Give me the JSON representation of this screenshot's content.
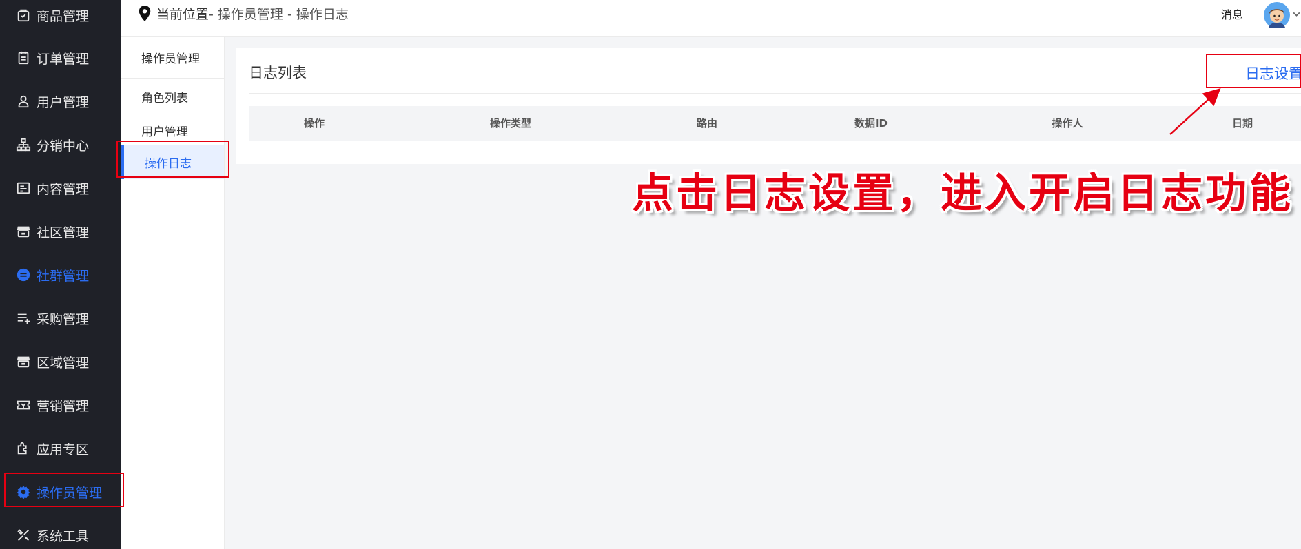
{
  "sidebar": {
    "items": [
      {
        "label": "商品管理",
        "icon": "bag-check-icon"
      },
      {
        "label": "订单管理",
        "icon": "clipboard-icon"
      },
      {
        "label": "用户管理",
        "icon": "user-icon"
      },
      {
        "label": "分销中心",
        "icon": "org-chart-icon"
      },
      {
        "label": "内容管理",
        "icon": "content-card-icon"
      },
      {
        "label": "社区管理",
        "icon": "store-icon"
      },
      {
        "label": "社群管理",
        "icon": "group-chat-icon"
      },
      {
        "label": "采购管理",
        "icon": "list-add-icon"
      },
      {
        "label": "区域管理",
        "icon": "store-icon"
      },
      {
        "label": "营销管理",
        "icon": "ticket-icon"
      },
      {
        "label": "应用专区",
        "icon": "puzzle-icon"
      },
      {
        "label": "操作员管理",
        "icon": "gear-icon"
      },
      {
        "label": "系统工具",
        "icon": "tools-icon"
      }
    ]
  },
  "header": {
    "location_prefix": "当前位置",
    "breadcrumb_rest": " - 操作员管理 - 操作日志",
    "message_label": "消息",
    "avatar_icon": "avatar-icon",
    "chevron_icon": "chevron-down-icon"
  },
  "subnav": {
    "title": "操作员管理",
    "items": [
      "角色列表",
      "用户管理",
      "操作日志"
    ]
  },
  "card": {
    "title": "日志列表",
    "settings_link": "日志设置",
    "columns": [
      "操作",
      "操作类型",
      "路由",
      "数据ID",
      "操作人",
      "日期"
    ]
  },
  "annotation": {
    "text": "点击日志设置，进入开启日志功能"
  },
  "colors": {
    "accent": "#2b6cf0",
    "sidebar_bg": "#1f2128",
    "annotation_red": "#e60012"
  }
}
